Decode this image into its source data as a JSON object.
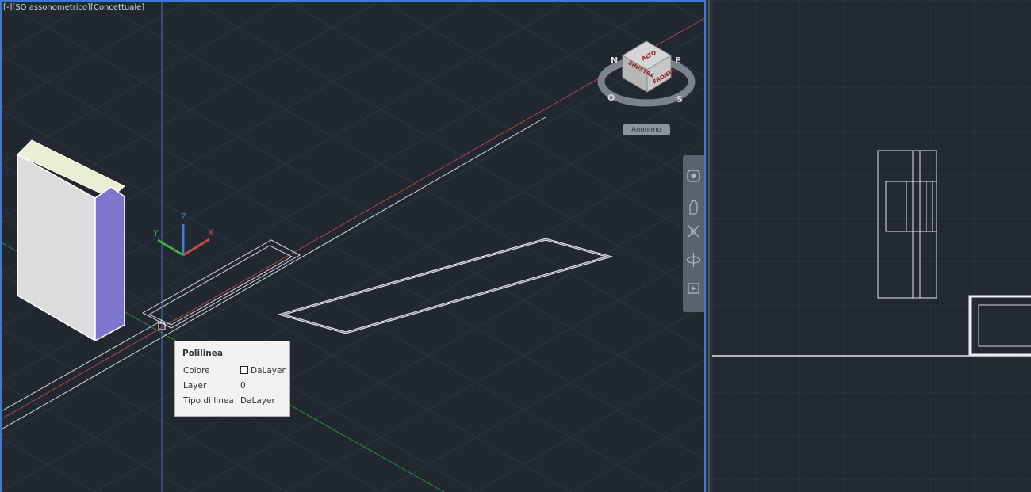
{
  "viewport_left": {
    "label": "[-][SO assonometrico][Concettuale]"
  },
  "viewcube": {
    "faces": {
      "top": "ALTO",
      "left": "SINISTRA",
      "front": "FRONTE"
    },
    "compass": {
      "north": "N",
      "west": "O",
      "south": "S",
      "east": "E"
    },
    "ucs_menu": "Anonimo"
  },
  "ucs_icon": {
    "x": "X",
    "y": "Y",
    "z": "Z"
  },
  "tooltip": {
    "title": "Polilinea",
    "rows": [
      {
        "label": "Colore",
        "value": "DaLayer"
      },
      {
        "label": "Layer",
        "value": "0"
      },
      {
        "label": "Tipo di linea",
        "value": "DaLayer"
      }
    ]
  },
  "navbar": {
    "tools": [
      "steering-wheel",
      "pan",
      "zoom-extents",
      "orbit",
      "showmotion"
    ]
  },
  "colors": {
    "background": "#212830",
    "active_viewport_border": "#3b7bd0",
    "x_axis": "#c84a4a",
    "y_axis": "#3fae3f",
    "z_axis": "#3f7fd8"
  }
}
